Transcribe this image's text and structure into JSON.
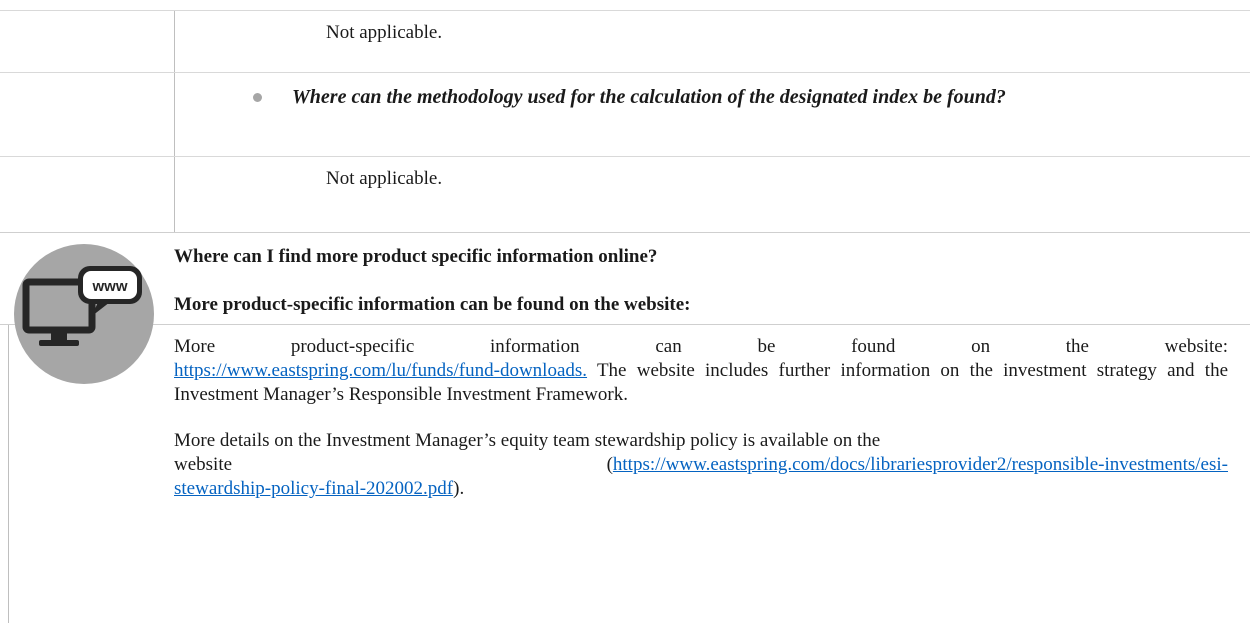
{
  "rows": {
    "r1_text": "Not applicable.",
    "r2_question": "Where can the methodology used for the calculation of the designated index be found?",
    "r3_text": "Not applicable."
  },
  "online": {
    "icon": "www-monitor-icon",
    "icon_label": "www",
    "heading": "Where can I find more product specific information online?",
    "subheading": "More product-specific information can be found on the website:",
    "p1_words": [
      "More",
      "product-specific",
      "information",
      "can",
      "be",
      "found",
      "on",
      "the",
      "website:"
    ],
    "p1_link": "https://www.eastspring.com/lu/funds/fund-downloads.",
    "p1_rest": " The website includes further information on the investment strategy and the Investment Manager’s Responsible Investment Framework.",
    "p2_line1": "More details on the Investment Manager’s equity team stewardship policy is available on the",
    "p2_prefix": "website",
    "p2_link1": "https://www.eastspring.com/docs/librariesprovider2/responsible-investments/esi-",
    "p2_link2": "stewardship-policy-final-202002.pdf",
    "p2_suffix": ")."
  },
  "colors": {
    "link": "#0563c1",
    "icon_circle": "#a6a6a6",
    "icon_dark": "#262626"
  }
}
